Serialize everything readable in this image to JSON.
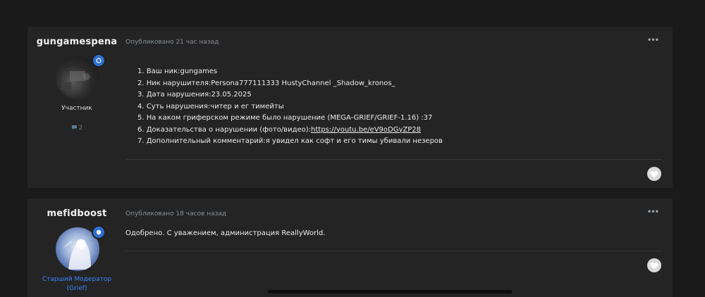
{
  "posts": [
    {
      "author": "gungamespena",
      "role": "Участник",
      "reputation": "2",
      "published": "Опубликовано 21 час назад",
      "more": "•••",
      "lines": [
        "1. Ваш ник:gungames",
        "2. Ник нарушителя:Persona777111333 HustyChannel _Shadow_kronos_",
        "3. Дата нарушения:23.05.2025",
        "4. Суть нарушения:читер и ег тимейты",
        "5. На каком гриферском режиме было нарушение (MEGA-GRIEF/GRIEF-1.16) :37",
        "6. Доказательства о нарушении (фото/видео):",
        "7. Дополнительный комментарий:я увидел как софт и его тимы убивали незеров"
      ],
      "link": "https://youtu.be/eV9oDGyZP28"
    },
    {
      "author": "mefidboost",
      "role_line1": "Старший Модератор",
      "role_line2": "(Grief)",
      "published": "Опубликовано 18 часов назад",
      "more": "•••",
      "text": "Одобрено. С уважением, администрация ReallyWorld."
    }
  ],
  "colors": {
    "accent": "#3a86ff",
    "badge": "#2f6fd1",
    "background": "#1a1a1a",
    "card": "#242424"
  }
}
